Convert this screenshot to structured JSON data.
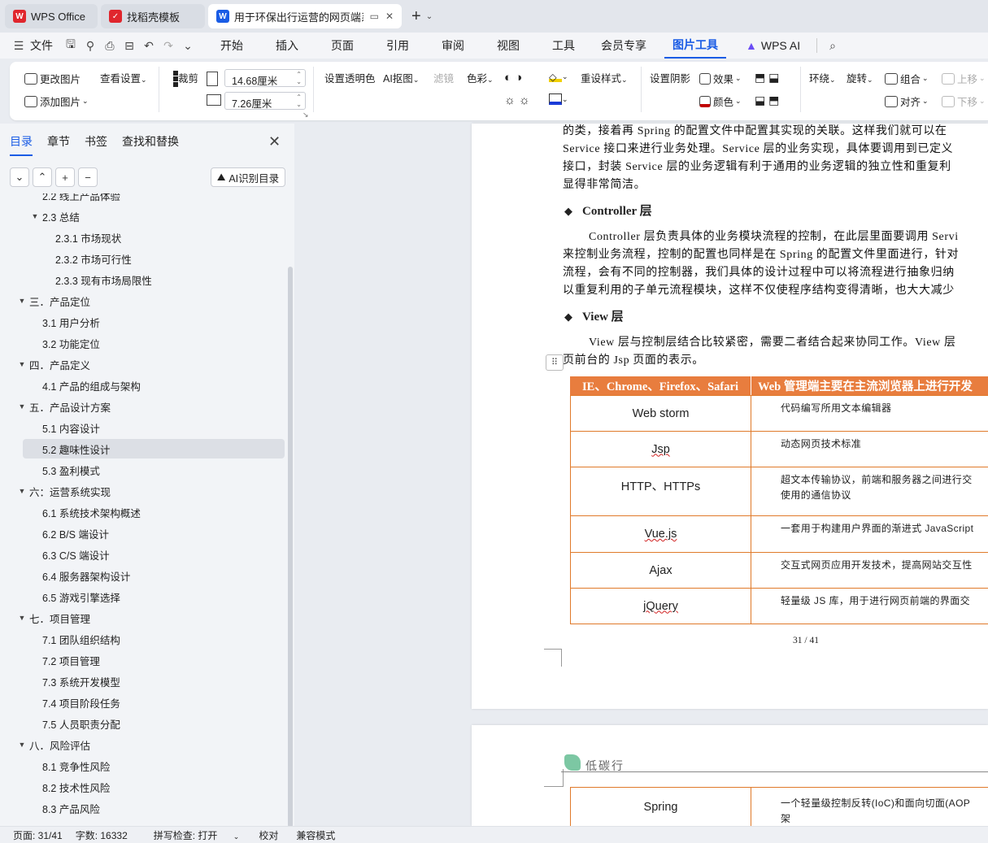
{
  "tabs": [
    {
      "label": "WPS Office",
      "logo": "W",
      "color": "#e0262d"
    },
    {
      "label": "找稻壳模板",
      "logo": "找",
      "color": "#e0262d"
    },
    {
      "label": "用于环保出行运营的网页端系",
      "logo": "W",
      "color": "#1a5ce5"
    }
  ],
  "menubar": {
    "file": "文件",
    "items": [
      "开始",
      "插入",
      "页面",
      "引用",
      "审阅",
      "视图",
      "工具",
      "会员专享",
      "图片工具",
      "WPS AI"
    ],
    "active": "图片工具"
  },
  "ribbon": {
    "change_image": "更改图片",
    "add_image": "添加图片",
    "view_settings": "查看设置",
    "crop": "裁剪",
    "width": "14.68厘米",
    "height": "7.26厘米",
    "transparent": "设置透明色",
    "ai_cutout": "AI抠图",
    "filter": "滤镜",
    "color_adj": "色彩",
    "reset_style": "重设样式",
    "shadow": "设置阴影",
    "effect": "效果",
    "color": "颜色",
    "wrap": "环绕",
    "rotate": "旋转",
    "group": "组合",
    "align": "对齐",
    "up": "上移",
    "down": "下移"
  },
  "sidebar": {
    "tabs": [
      "目录",
      "章节",
      "书签",
      "查找和替换"
    ],
    "ai_toc": "AI识别目录",
    "items": [
      {
        "t": "2.2  线上产品体验",
        "lvl": 2,
        "caret": false
      },
      {
        "t": "2.3  总结",
        "lvl": 2,
        "caret": true
      },
      {
        "t": "2.3.1  市场现状",
        "lvl": 3,
        "caret": false
      },
      {
        "t": "2.3.2  市场可行性",
        "lvl": 3,
        "caret": false
      },
      {
        "t": "2.3.3  现有市场局限性",
        "lvl": 3,
        "caret": false
      },
      {
        "t": "三．产品定位",
        "lvl": 1,
        "caret": true
      },
      {
        "t": "3.1  用户分析",
        "lvl": 2,
        "caret": false
      },
      {
        "t": "3.2  功能定位",
        "lvl": 2,
        "caret": false
      },
      {
        "t": "四．产品定义",
        "lvl": 1,
        "caret": true
      },
      {
        "t": "4.1  产品的组成与架构",
        "lvl": 2,
        "caret": false
      },
      {
        "t": "五．产品设计方案",
        "lvl": 1,
        "caret": true
      },
      {
        "t": "5.1 内容设计",
        "lvl": 2,
        "caret": false
      },
      {
        "t": "5.2  趣味性设计",
        "lvl": 2,
        "caret": false,
        "selected": true
      },
      {
        "t": "5.3  盈利模式",
        "lvl": 2,
        "caret": false
      },
      {
        "t": "六：运营系统实现",
        "lvl": 1,
        "caret": true
      },
      {
        "t": "6.1  系统技术架构概述",
        "lvl": 2,
        "caret": false
      },
      {
        "t": "6.2 B/S 端设计",
        "lvl": 2,
        "caret": false
      },
      {
        "t": "6.3 C/S 端设计",
        "lvl": 2,
        "caret": false
      },
      {
        "t": "6.4 服务器架构设计",
        "lvl": 2,
        "caret": false
      },
      {
        "t": "6.5 游戏引擎选择",
        "lvl": 2,
        "caret": false
      },
      {
        "t": "七．项目管理",
        "lvl": 1,
        "caret": true
      },
      {
        "t": "7.1  团队组织结构",
        "lvl": 2,
        "caret": false
      },
      {
        "t": "7.2  项目管理",
        "lvl": 2,
        "caret": false
      },
      {
        "t": "7.3  系统开发模型",
        "lvl": 2,
        "caret": false
      },
      {
        "t": "7.4  项目阶段任务",
        "lvl": 2,
        "caret": false
      },
      {
        "t": "7.5  人员职责分配",
        "lvl": 2,
        "caret": false
      },
      {
        "t": "八．风险评估",
        "lvl": 1,
        "caret": true
      },
      {
        "t": "8.1  竞争性风险",
        "lvl": 2,
        "caret": false
      },
      {
        "t": "8.2  技术性风险",
        "lvl": 2,
        "caret": false
      },
      {
        "t": "8.3  产品风险",
        "lvl": 2,
        "caret": false
      }
    ]
  },
  "doc": {
    "para1": [
      "的类，接着再 Spring 的配置文件中配置其实现的关联。这样我们就可以在",
      "Service 接口来进行业务处理。Service 层的业务实现，具体要调用到已定义",
      "接口，封装 Service 层的业务逻辑有利于通用的业务逻辑的独立性和重复利",
      "显得非常简洁。"
    ],
    "h_controller": "Controller 层",
    "para2": [
      "Controller 层负责具体的业务模块流程的控制，在此层里面要调用 Servi",
      "来控制业务流程，控制的配置也同样是在 Spring 的配置文件里面进行，针对",
      "流程，会有不同的控制器，我们具体的设计过程中可以将流程进行抽象归纳",
      "以重复利用的子单元流程模块，这样不仅使程序结构变得清晰，也大大减少"
    ],
    "h_view": "View 层",
    "para3": [
      "View 层与控制层结合比较紧密，需要二者结合起来协同工作。View 层",
      "页前台的 Jsp 页面的表示。"
    ],
    "table_head": [
      "IE、Chrome、Firefox、Safari",
      "Web 管理端主要在主流浏览器上进行开发"
    ],
    "rows": [
      {
        "k": "Web storm",
        "v": [
          "代码编写所用文本编辑器"
        ]
      },
      {
        "k": "Jsp",
        "v": [
          "动态网页技术标准"
        ]
      },
      {
        "k": "HTTP、HTTPs",
        "v": [
          "超文本传输协议，前端和服务器之间进行交",
          "使用的通信协议"
        ]
      },
      {
        "k": "Vue.js",
        "v": [
          "一套用于构建用户界面的渐进式 JavaScript"
        ]
      },
      {
        "k": "Ajax",
        "v": [
          "交互式网页应用开发技术，提高网站交互性"
        ]
      },
      {
        "k": "jQuery",
        "v": [
          "轻量级 JS 库，用于进行网页前端的界面交"
        ]
      }
    ],
    "page_num": "31 / 41",
    "header2": "低碳行",
    "row2": {
      "k": "Spring",
      "v": [
        "一个轻量级控制反转(IoC)和面向切面(AOP",
        "架"
      ]
    }
  },
  "status": {
    "page": "页面: 31/41",
    "words": "字数: 16332",
    "spell": "拼写检查: 打开",
    "proof": "校对",
    "compat": "兼容模式"
  }
}
